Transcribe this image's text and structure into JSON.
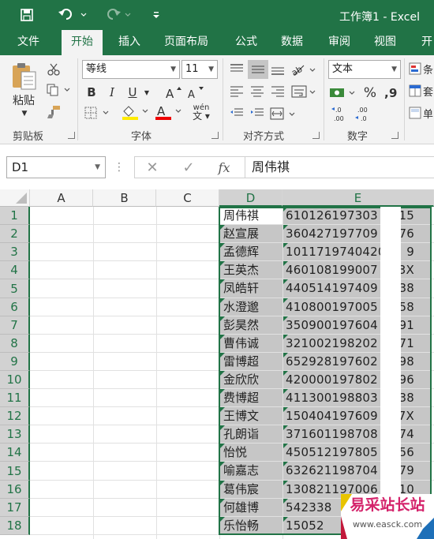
{
  "app": {
    "title": "工作簿1 - Excel",
    "accent": "#217346"
  },
  "qat": [
    "save-icon",
    "undo-icon",
    "redo-icon",
    "customize-icon"
  ],
  "tabs": [
    "文件",
    "开始",
    "插入",
    "页面布局",
    "公式",
    "数据",
    "审阅",
    "视图",
    "开"
  ],
  "ribbon": {
    "clipboard": {
      "label": "剪贴板",
      "paste": "粘贴"
    },
    "font": {
      "label": "字体",
      "name": "等线",
      "size": "11",
      "bold": "B",
      "italic": "I",
      "underline": "U"
    },
    "alignment": {
      "label": "对齐方式"
    },
    "number": {
      "label": "数字",
      "format": "文本"
    },
    "wen": "wén"
  },
  "formula_bar": {
    "name_box": "D1",
    "cancel": "✕",
    "enter": "✓",
    "fx": "fx",
    "value": "周伟祺"
  },
  "columns": [
    "A",
    "B",
    "C",
    "D",
    "E"
  ],
  "rows": [
    {
      "n": "1",
      "name": "周伟祺",
      "id_left": "610126197303",
      "id_right": "15"
    },
    {
      "n": "2",
      "name": "赵宣展",
      "id_left": "360427197709",
      "id_right": "76"
    },
    {
      "n": "3",
      "name": "孟德辉",
      "id_left": "1011719740420",
      "id_right": "9"
    },
    {
      "n": "4",
      "name": "王英杰",
      "id_left": "460108199007",
      "id_right": "3X"
    },
    {
      "n": "5",
      "name": "凤皓轩",
      "id_left": "440514197409",
      "id_right": "38"
    },
    {
      "n": "6",
      "name": "水澄邈",
      "id_left": "410800197005",
      "id_right": "58"
    },
    {
      "n": "7",
      "name": "彭昊然",
      "id_left": "350900197604",
      "id_right": "91"
    },
    {
      "n": "8",
      "name": "曹伟诚",
      "id_left": "321002198202",
      "id_right": "71"
    },
    {
      "n": "9",
      "name": "雷博超",
      "id_left": "652928197602",
      "id_right": "98"
    },
    {
      "n": "10",
      "name": "金欣欣",
      "id_left": "420000197802",
      "id_right": "96"
    },
    {
      "n": "11",
      "name": "费博超",
      "id_left": "411300198803",
      "id_right": "38"
    },
    {
      "n": "12",
      "name": "王博文",
      "id_left": "150404197609",
      "id_right": "7X"
    },
    {
      "n": "13",
      "name": "孔朗诣",
      "id_left": "371601198708",
      "id_right": "74"
    },
    {
      "n": "14",
      "name": "怡悦",
      "id_left": "450512197805",
      "id_right": "56"
    },
    {
      "n": "15",
      "name": "喻嘉志",
      "id_left": "632621198704",
      "id_right": "79"
    },
    {
      "n": "16",
      "name": "葛伟宸",
      "id_left": "130821197006",
      "id_right": "10"
    },
    {
      "n": "17",
      "name": "何雄博",
      "id_left": "542338",
      "id_right": ""
    },
    {
      "n": "18",
      "name": "乐怡畅",
      "id_left": "15052",
      "id_right": ""
    }
  ],
  "watermark": {
    "text": "易采站长站",
    "url": "www.easck.com"
  }
}
